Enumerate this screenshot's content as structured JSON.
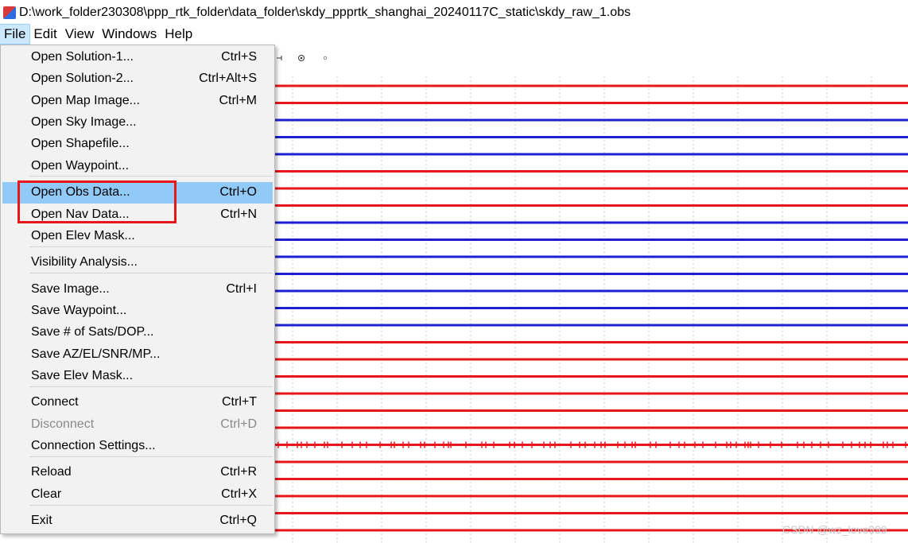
{
  "window": {
    "title": "D:\\work_folder230308\\ppp_rtk_folder\\data_folder\\skdy_ppprtk_shanghai_20240117C_static\\skdy_raw_1.obs"
  },
  "menubar": [
    "File",
    "Edit",
    "View",
    "Windows",
    "Help"
  ],
  "file_menu": {
    "items": [
      {
        "label": "Open Solution-1...",
        "shortcut": "Ctrl+S"
      },
      {
        "label": "Open Solution-2...",
        "shortcut": "Ctrl+Alt+S"
      },
      {
        "label": "Open Map Image...",
        "shortcut": "Ctrl+M"
      },
      {
        "label": "Open Sky Image...",
        "shortcut": ""
      },
      {
        "label": "Open Shapefile...",
        "shortcut": ""
      },
      {
        "label": "Open Waypoint...",
        "shortcut": ""
      },
      {
        "label": "Open Obs Data...",
        "shortcut": "Ctrl+O",
        "highlighted": true
      },
      {
        "label": "Open Nav Data...",
        "shortcut": "Ctrl+N"
      },
      {
        "label": "Open Elev Mask...",
        "shortcut": ""
      },
      {
        "label": "Visibility Analysis...",
        "shortcut": ""
      },
      {
        "label": "Save Image...",
        "shortcut": "Ctrl+I"
      },
      {
        "label": "Save Waypoint...",
        "shortcut": ""
      },
      {
        "label": "Save # of Sats/DOP...",
        "shortcut": ""
      },
      {
        "label": "Save AZ/EL/SNR/MP...",
        "shortcut": ""
      },
      {
        "label": "Save Elev Mask...",
        "shortcut": ""
      },
      {
        "label": "Connect",
        "shortcut": "Ctrl+T"
      },
      {
        "label": "Disconnect",
        "shortcut": "Ctrl+D",
        "disabled": true
      },
      {
        "label": "Connection Settings...",
        "shortcut": ""
      },
      {
        "label": "Reload",
        "shortcut": "Ctrl+R"
      },
      {
        "label": "Clear",
        "shortcut": "Ctrl+X"
      },
      {
        "label": "Exit",
        "shortcut": "Ctrl+Q"
      }
    ]
  },
  "annotation": {
    "color": "#e8161b"
  },
  "plot": {
    "line_colors": [
      "red",
      "red",
      "blue",
      "blue",
      "blue",
      "red",
      "red",
      "red",
      "blue",
      "blue",
      "blue",
      "blue",
      "blue",
      "blue",
      "blue",
      "red",
      "red",
      "red",
      "red",
      "red",
      "red",
      "red",
      "red",
      "red",
      "red",
      "red",
      "red"
    ],
    "red": "#e8161b",
    "blue": "#1d1fd0"
  },
  "watermark": "CSDN @wz_love999"
}
